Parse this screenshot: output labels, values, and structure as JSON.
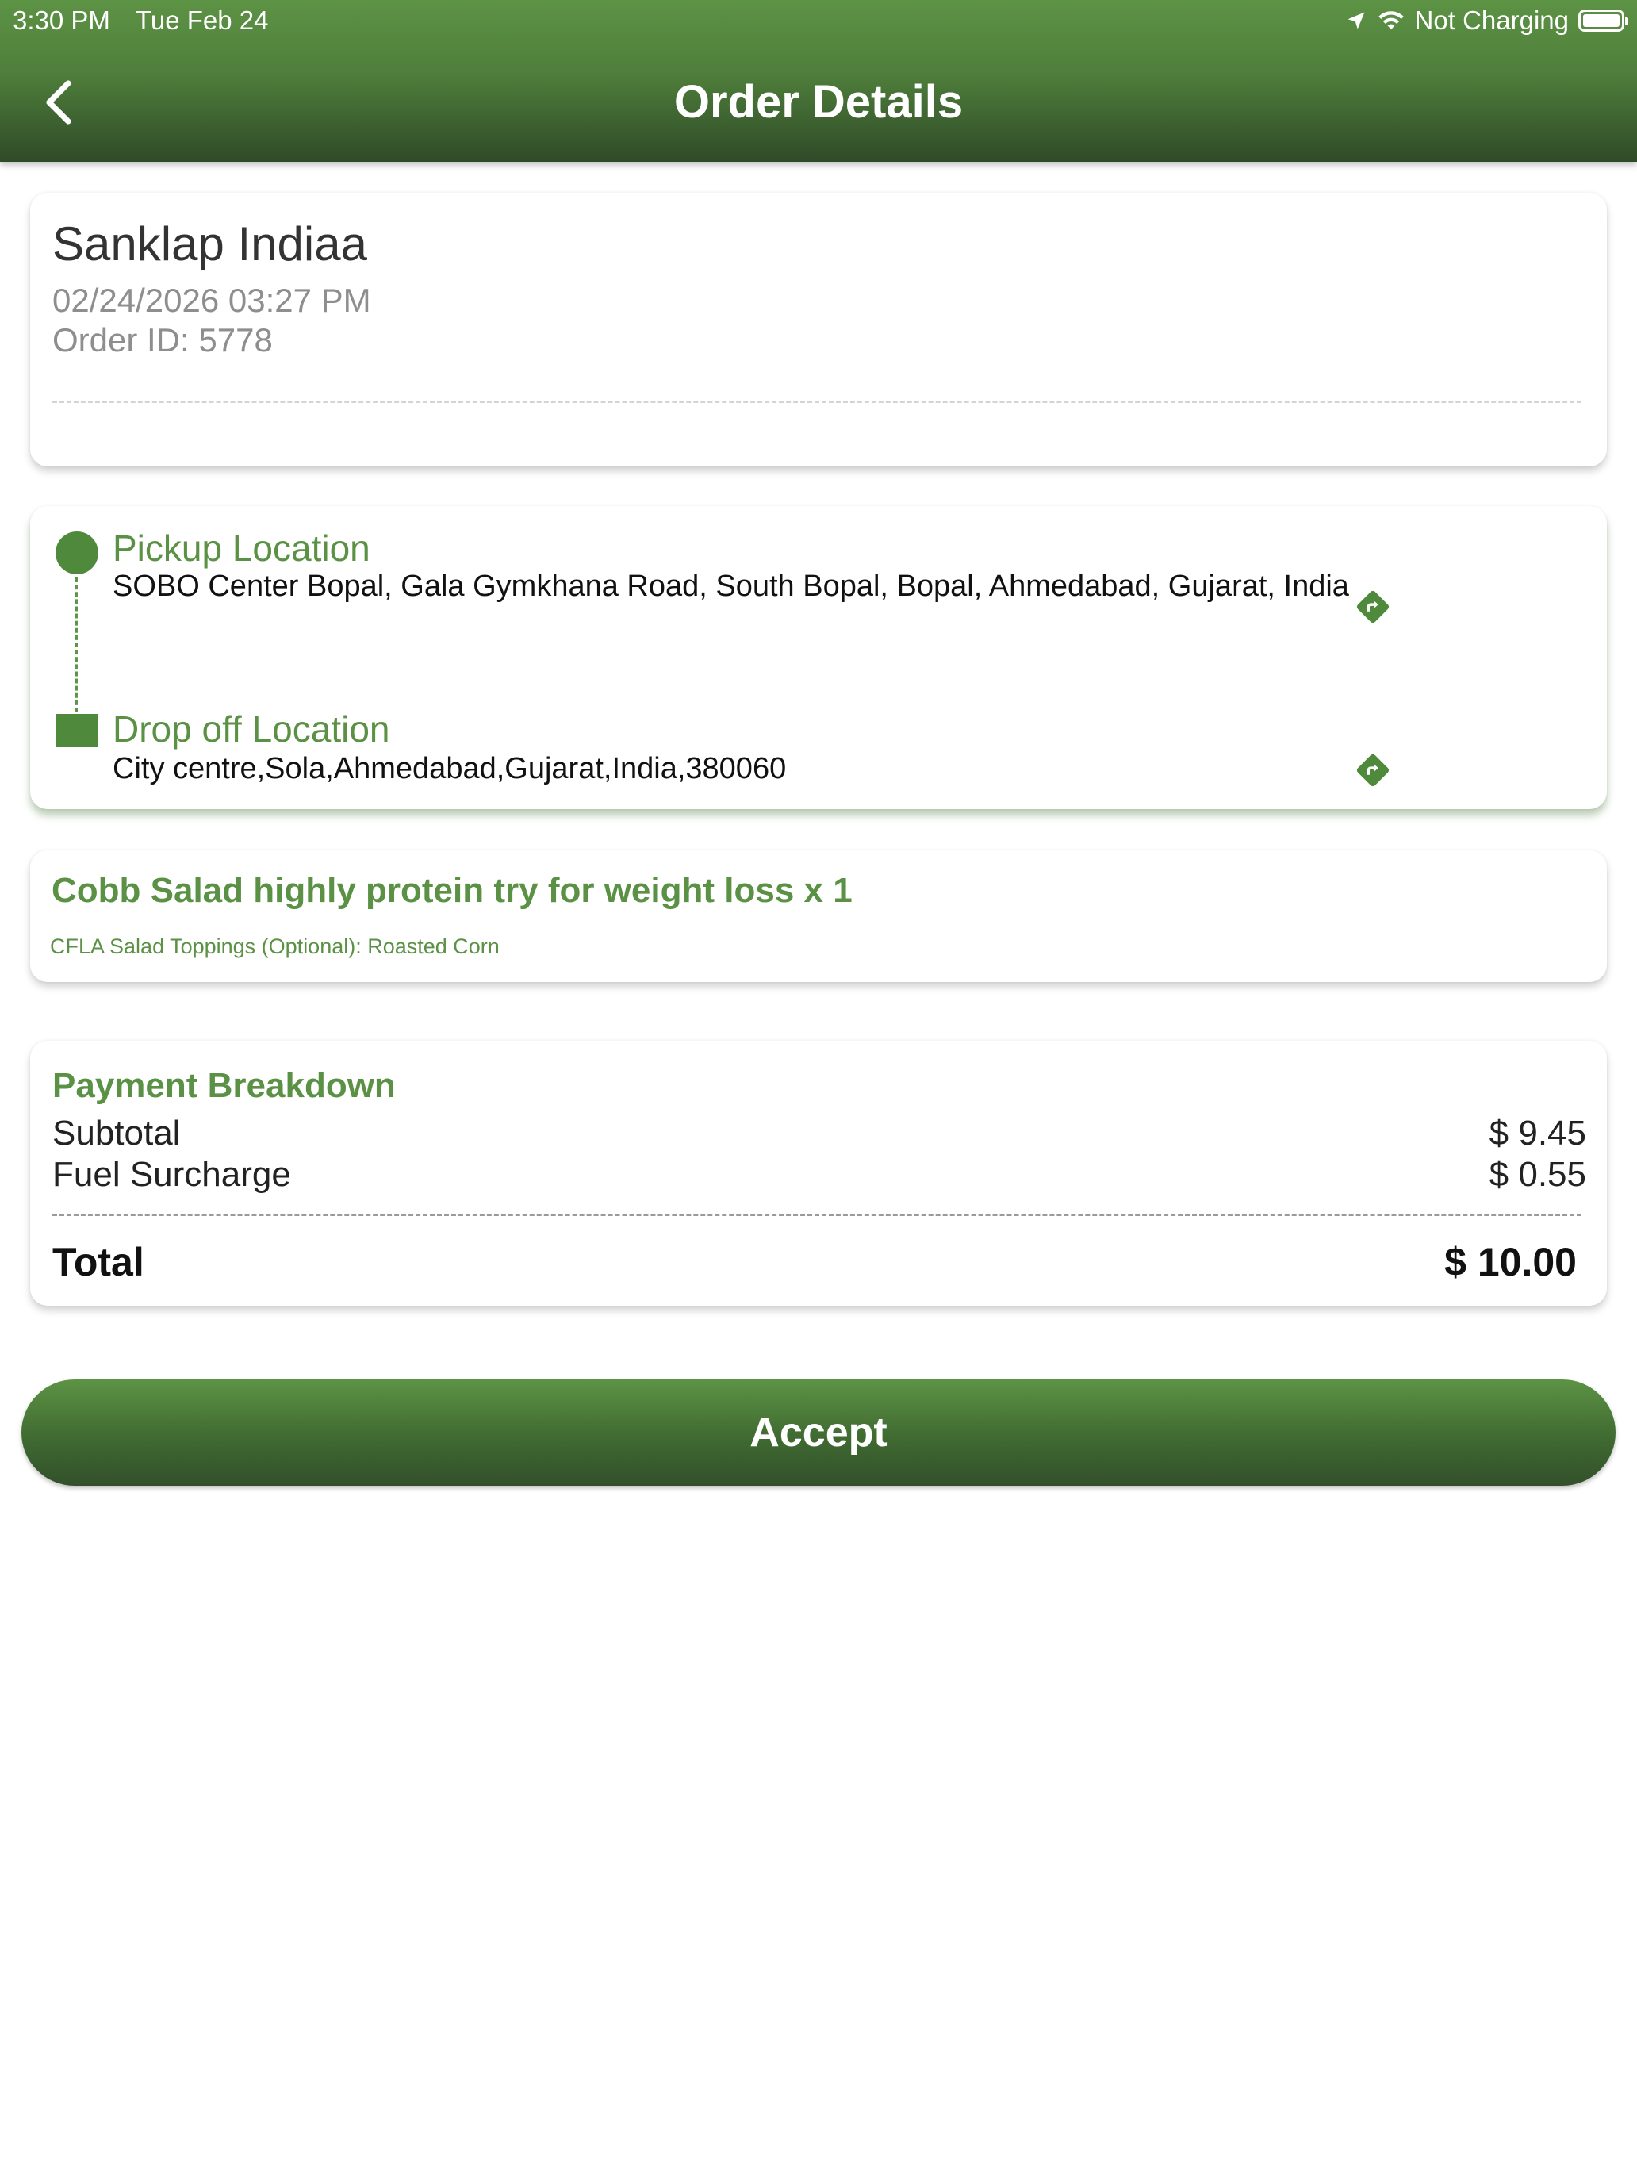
{
  "status_bar": {
    "time": "3:30 PM",
    "date": "Tue Feb 24",
    "charging": "Not Charging"
  },
  "header": {
    "title": "Order Details",
    "back_icon": "chevron-left-icon"
  },
  "order": {
    "customer_name": "Sanklap Indiaa",
    "datetime": "02/24/2026 03:27 PM",
    "order_id": "Order ID: 5778"
  },
  "locations": {
    "pickup": {
      "title": "Pickup Location",
      "address": "SOBO Center Bopal, Gala Gymkhana Road, South Bopal, Bopal, Ahmedabad, Gujarat, India"
    },
    "dropoff": {
      "title": "Drop off Location",
      "address": "City centre,Sola,Ahmedabad,Gujarat,India,380060"
    },
    "nav_icon": "directions-icon"
  },
  "item": {
    "name": "Cobb Salad highly protein try for weight loss x 1",
    "option": "CFLA Salad Toppings (Optional): Roasted Corn"
  },
  "payment": {
    "title": "Payment Breakdown",
    "subtotal_label": "Subtotal",
    "subtotal_value": "$ 9.45",
    "fuel_label": "Fuel Surcharge",
    "fuel_value": "$ 0.55",
    "total_label": "Total",
    "total_value": "$ 10.00"
  },
  "actions": {
    "accept_label": "Accept"
  },
  "colors": {
    "brand_green": "#4f8a3c",
    "text_green": "#5a9144",
    "header_dark": "#2f4a28"
  }
}
